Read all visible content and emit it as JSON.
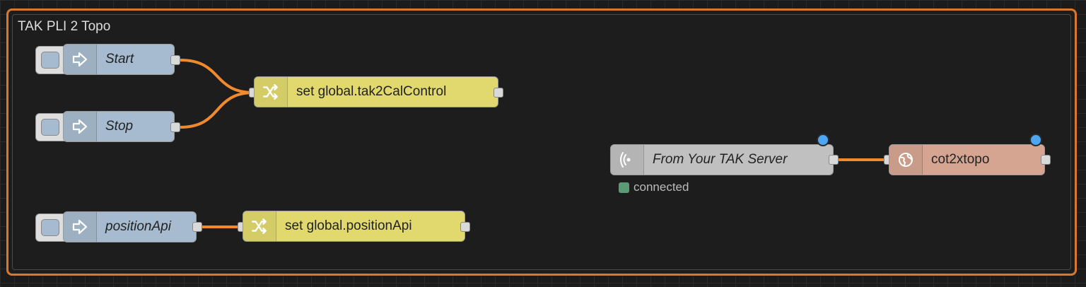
{
  "group": {
    "label": "TAK PLI 2 Topo",
    "border_color": "#d8782f"
  },
  "nodes": {
    "start": {
      "label": "Start",
      "type": "inject",
      "color": "#a6bbcf"
    },
    "stop": {
      "label": "Stop",
      "type": "inject",
      "color": "#a6bbcf"
    },
    "set_cal": {
      "label": "set global.tak2CalControl",
      "type": "change",
      "color": "#e2d96e"
    },
    "position_api": {
      "label": "positionApi",
      "type": "inject",
      "color": "#a6bbcf"
    },
    "set_position": {
      "label": "set global.positionApi",
      "type": "change",
      "color": "#e2d96e"
    },
    "tak_server": {
      "label": "From Your TAK Server",
      "type": "tcp-in",
      "color": "#c0c0c0",
      "status": "connected",
      "status_color": "#5a9a75"
    },
    "cot2xtopo": {
      "label": "cot2xtopo",
      "type": "function",
      "color": "#d6a592"
    }
  },
  "wire_color": "#f08a2c",
  "changed_indicator_color": "#4da6f2"
}
